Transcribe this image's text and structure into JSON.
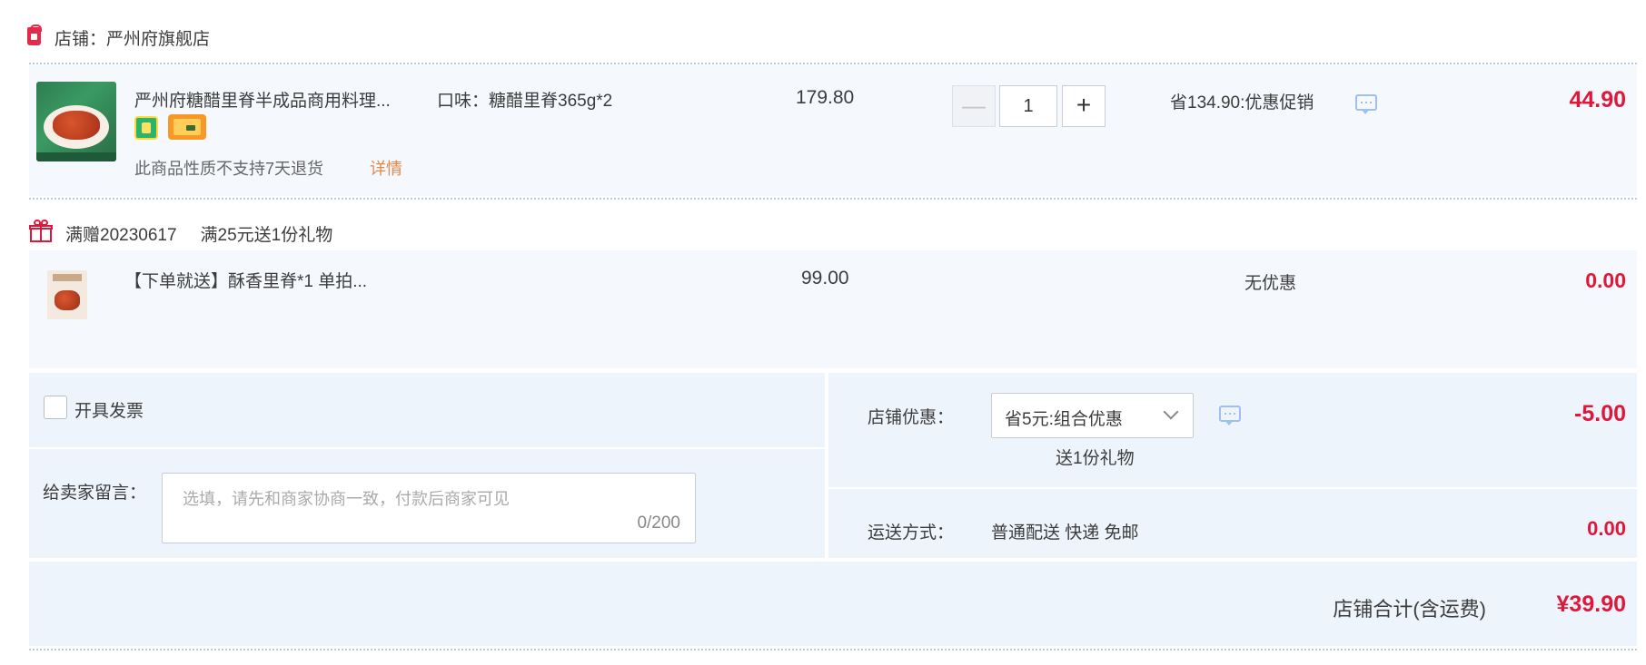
{
  "shop": {
    "label": "店铺：严州府旗舰店",
    "icon": "shop-icon"
  },
  "product": {
    "title": "严州府糖醋里脊半成品商用料理...",
    "flavor": "口味：糖醋里脊365g*2",
    "no_return_text": "此商品性质不支持7天退货",
    "detail_link": "详情",
    "original_price": "179.80",
    "quantity": "1",
    "minus_label": "—",
    "plus_label": "+",
    "promo_text": "省134.90:优惠促销",
    "final_price": "44.90"
  },
  "gift_promo": {
    "code": "满赠20230617",
    "desc": "满25元送1份礼物"
  },
  "gift_item": {
    "title": "【下单就送】酥香里脊*1 单拍...",
    "original_price": "99.00",
    "discount_text": "无优惠",
    "final_price": "0.00"
  },
  "invoice": {
    "label": "开具发票",
    "checked": false
  },
  "message": {
    "label": "给卖家留言：",
    "placeholder": "选填，请先和商家协商一致，付款后商家可见",
    "counter": "0/200"
  },
  "shop_discount": {
    "label": "店铺优惠：",
    "selected": "省5元:组合优惠",
    "gift_note": "送1份礼物",
    "amount": "-5.00"
  },
  "shipping": {
    "label": "运送方式：",
    "method": "普通配送 快递 免邮",
    "amount": "0.00"
  },
  "total": {
    "label": "店铺合计(含运费)",
    "value": "¥39.90"
  },
  "colors": {
    "accent_red": "#e0163a",
    "row_bg": "#f5f8fd",
    "panel_bg": "#eef4fc",
    "divider": "#b9cbe6"
  }
}
